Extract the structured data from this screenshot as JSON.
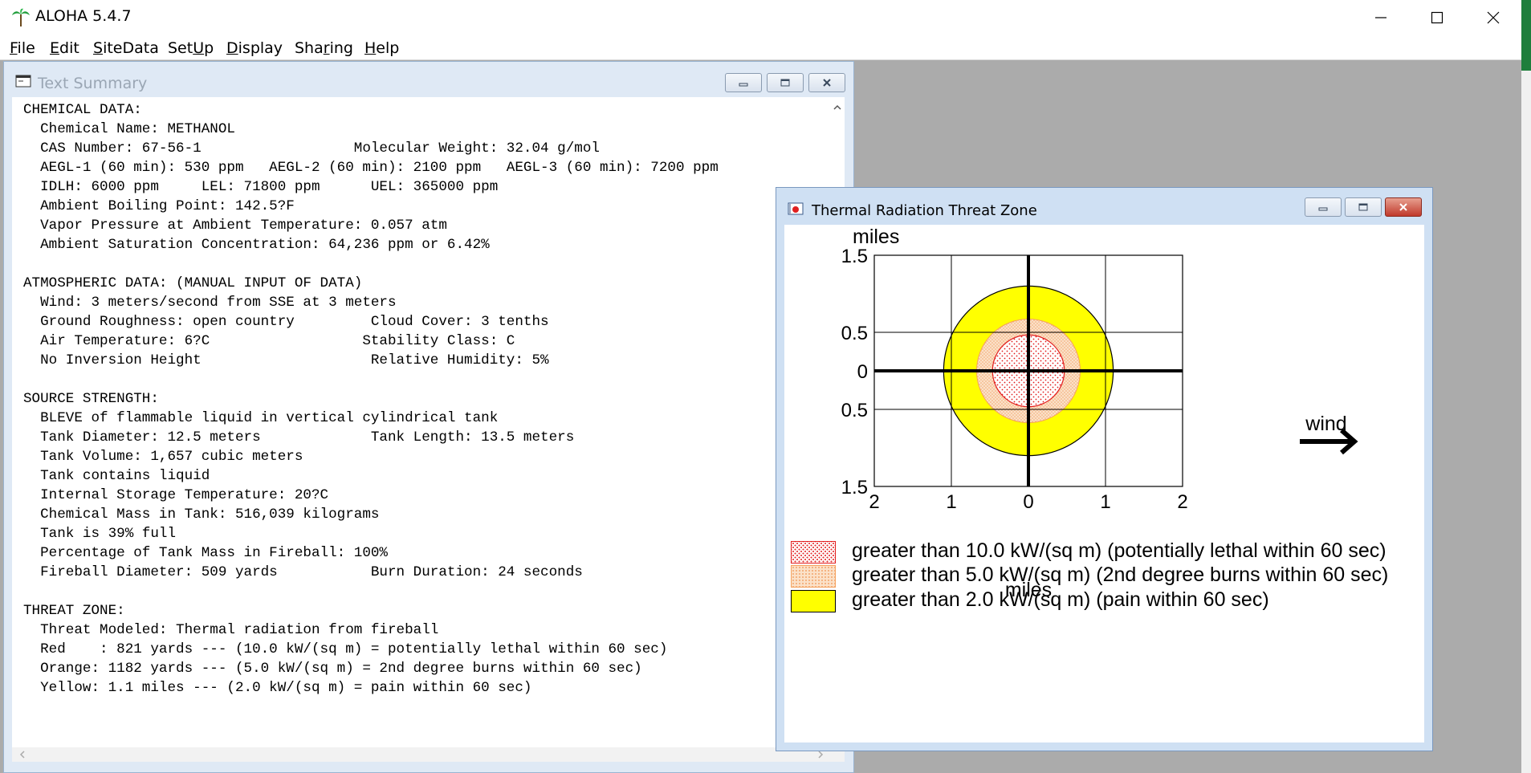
{
  "app": {
    "title": "ALOHA 5.4.7"
  },
  "menu": [
    {
      "label": "File",
      "accel": "F",
      "rest": "ile"
    },
    {
      "label": "Edit",
      "accel": "E",
      "rest": "dit"
    },
    {
      "label": "SiteData",
      "accel": "S",
      "rest": "iteData"
    },
    {
      "label": "SetUp",
      "pre": "Set",
      "accel": "U",
      "rest": "p"
    },
    {
      "label": "Display",
      "accel": "D",
      "rest": "isplay"
    },
    {
      "label": "Sharing",
      "pre": "Sha",
      "accel": "r",
      "rest": "ing"
    },
    {
      "label": "Help",
      "accel": "H",
      "rest": "elp"
    }
  ],
  "text_summary": {
    "title": "Text Summary",
    "lines": [
      "CHEMICAL DATA:",
      "  Chemical Name: METHANOL",
      "  CAS Number: 67-56-1                  Molecular Weight: 32.04 g/mol",
      "  AEGL-1 (60 min): 530 ppm   AEGL-2 (60 min): 2100 ppm   AEGL-3 (60 min): 7200 ppm",
      "  IDLH: 6000 ppm     LEL: 71800 ppm      UEL: 365000 ppm",
      "  Ambient Boiling Point: 142.5?F",
      "  Vapor Pressure at Ambient Temperature: 0.057 atm",
      "  Ambient Saturation Concentration: 64,236 ppm or 6.42%",
      "",
      "ATMOSPHERIC DATA: (MANUAL INPUT OF DATA)",
      "  Wind: 3 meters/second from SSE at 3 meters",
      "  Ground Roughness: open country         Cloud Cover: 3 tenths",
      "  Air Temperature: 6?C                  Stability Class: C",
      "  No Inversion Height                    Relative Humidity: 5%",
      "",
      "SOURCE STRENGTH:",
      "  BLEVE of flammable liquid in vertical cylindrical tank",
      "  Tank Diameter: 12.5 meters             Tank Length: 13.5 meters",
      "  Tank Volume: 1,657 cubic meters",
      "  Tank contains liquid",
      "  Internal Storage Temperature: 20?C",
      "  Chemical Mass in Tank: 516,039 kilograms",
      "  Tank is 39% full",
      "  Percentage of Tank Mass in Fireball: 100%",
      "  Fireball Diameter: 509 yards           Burn Duration: 24 seconds",
      "",
      "THREAT ZONE:",
      "  Threat Modeled: Thermal radiation from fireball",
      "  Red    : 821 yards --- (10.0 kW/(sq m) = potentially lethal within 60 sec)",
      "  Orange: 1182 yards --- (5.0 kW/(sq m) = 2nd degree burns within 60 sec)",
      "  Yellow: 1.1 miles --- (2.0 kW/(sq m) = pain within 60 sec)"
    ]
  },
  "threat_zone": {
    "title": "Thermal Radiation Threat Zone",
    "y_unit": "miles",
    "x_unit": "miles",
    "y_ticks": [
      "1.5",
      "0.5",
      "0",
      "0.5",
      "1.5"
    ],
    "x_ticks": [
      "2",
      "1",
      "0",
      "1",
      "2"
    ],
    "wind_label": "wind",
    "zones": [
      {
        "name": "Yellow",
        "radius_miles": 1.1,
        "color": "#ffff00"
      },
      {
        "name": "Orange",
        "radius_miles": 0.672,
        "color": "#f9ceaa"
      },
      {
        "name": "Red",
        "radius_miles": 0.466,
        "color": "#ff0000"
      }
    ],
    "legend": [
      {
        "label": "greater than 10.0 kW/(sq m) (potentially lethal within 60 sec)",
        "style": "red"
      },
      {
        "label": "greater than 5.0 kW/(sq m) (2nd degree burns within 60 sec)",
        "style": "orange"
      },
      {
        "label": "greater than 2.0 kW/(sq m) (pain within 60 sec)",
        "style": "yellow"
      }
    ]
  }
}
